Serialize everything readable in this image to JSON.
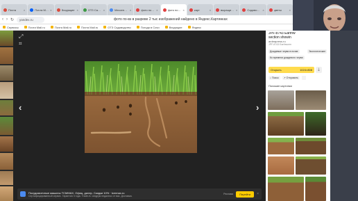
{
  "browser": {
    "tabs": [
      {
        "label": "Почта",
        "color": "#d94b3d",
        "active": false
      },
      {
        "label": "Почта Mail.ru",
        "color": "#005ff9",
        "active": false
      },
      {
        "label": "Входящие",
        "color": "#d94b3d",
        "active": false
      },
      {
        "label": "ОТЗ Садоводство",
        "color": "#3d9a45",
        "active": false
      },
      {
        "label": "Мессенджер",
        "color": "#4b8bf0",
        "active": false
      },
      {
        "label": "фото почва в",
        "color": "#e04040",
        "active": false
      },
      {
        "label": "фото по-вз",
        "color": "#e04040",
        "active": true
      },
      {
        "label": "карт",
        "color": "#e04040",
        "active": false
      },
      {
        "label": "выращивание груш",
        "color": "#e04040",
        "active": false
      },
      {
        "label": "Садоводство",
        "color": "#e04040",
        "active": false
      },
      {
        "label": "цветы",
        "color": "#e04040",
        "active": false
      }
    ],
    "url": "yandex.ru",
    "page_title": "фото по-вз в разреве 2 тыс изображений найдено в Яндекс.Картинках",
    "bookmarks": [
      "Сервисы",
      "Почта Mail.ru",
      "Почта Mail.ru",
      "Почта Mail.ru",
      "ОТЗ Садоводство",
      "Погода в Сочи",
      "Входящие",
      "Яндекс"
    ]
  },
  "viewer": {
    "expand_icon": "expand-icon",
    "crop_icon": "crop-icon",
    "prev_icon": "chevron-left-icon",
    "next_icon": "chevron-right-icon"
  },
  "ad": {
    "title": "Посудомоечные машины TCMMAX. Офиц. дилер. Скидки 10% · tcmmax.ru",
    "description": "Сертифицированный сервис. Гарантия 3 года. Trade-in. Шоурум недалеко от вас. Доставка.",
    "badge": "Реклама",
    "button_label": "Перейти"
  },
  "panel": {
    "title_line1": "JPF-8743 Earthw",
    "title_line2": "section showin",
    "site": "ardeapress.ru",
    "size": "JPF-8743 Earthworm",
    "chip1": "Дождевые черви в почве",
    "chip2": "Экологические",
    "chip3": "Ко времени дождевого черва",
    "open_label": "Открыть",
    "open_size": "1024×808",
    "share_label": "Поиск",
    "send_label": "Отправить",
    "similar_header": "Похожие картинки"
  }
}
